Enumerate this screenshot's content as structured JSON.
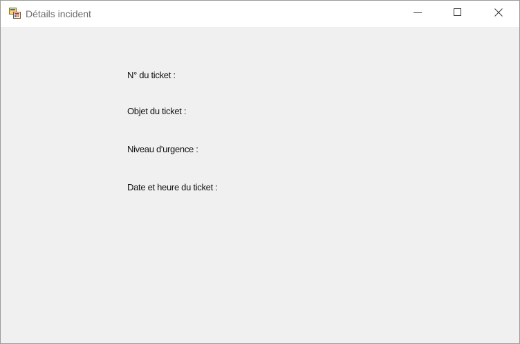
{
  "window": {
    "title": "Détails incident",
    "icon": "winforms-app-icon",
    "controls": {
      "minimize_icon": "minimize-icon",
      "maximize_icon": "maximize-icon",
      "close_icon": "close-icon"
    }
  },
  "form": {
    "labels": {
      "ticket_number": "N° du ticket :",
      "ticket_subject": "Objet du ticket :",
      "urgency_level": "Niveau d'urgence :",
      "ticket_datetime": "Date et heure du ticket :"
    }
  },
  "colors": {
    "titlebar": "#ffffff",
    "client_background": "#f0f0f0",
    "title_text": "#6f6f6f",
    "label_text": "#111111"
  }
}
